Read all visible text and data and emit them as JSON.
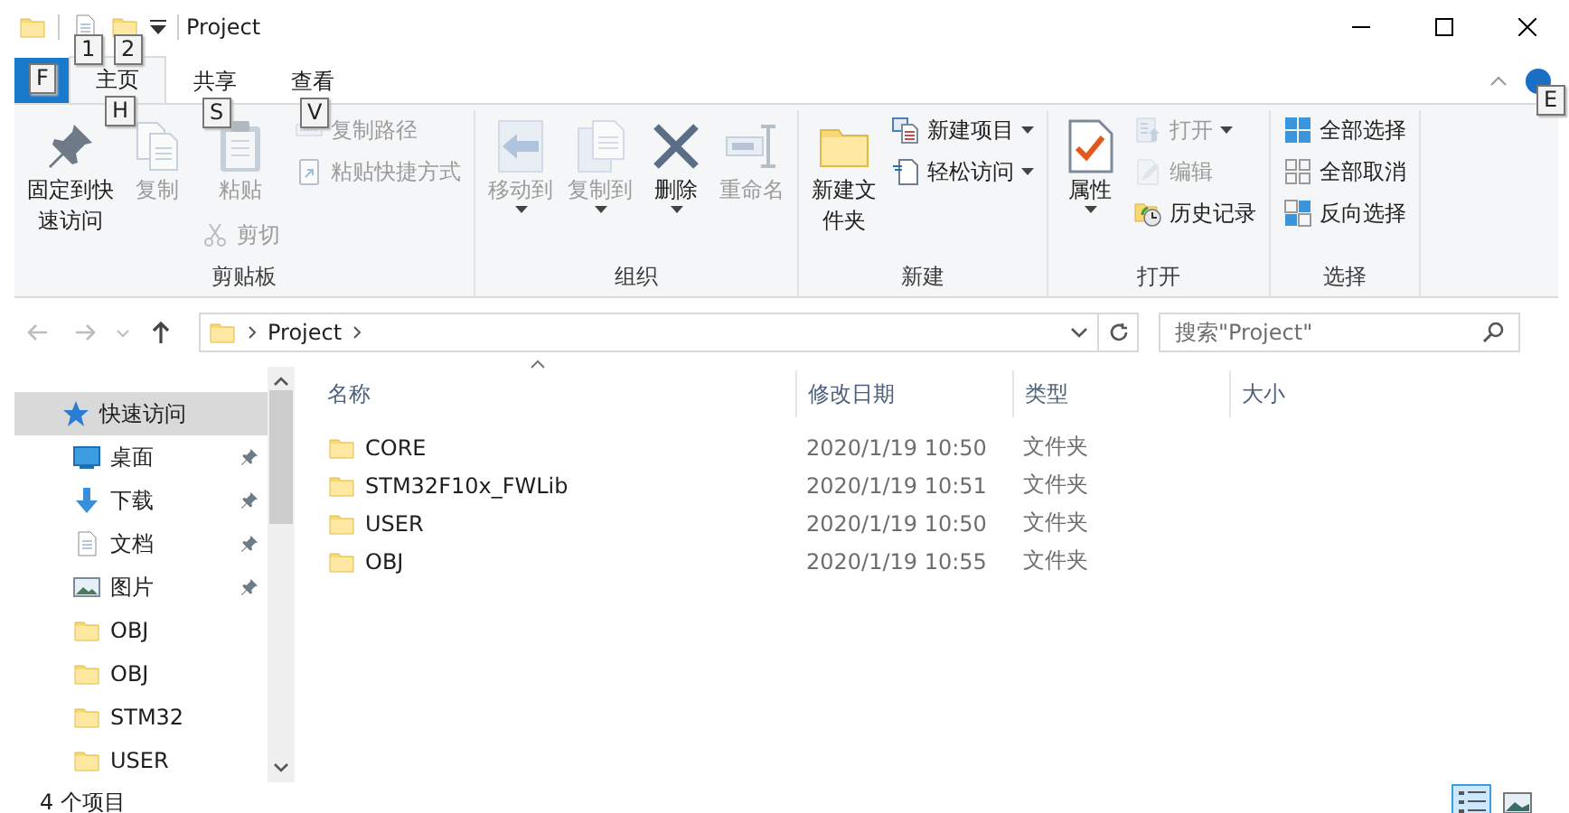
{
  "window": {
    "title": "Project"
  },
  "quick_access_toolbar": [
    {
      "keytip": "1"
    },
    {
      "keytip": "2"
    }
  ],
  "ribbon_tabs": [
    {
      "kind": "file",
      "keytip": "F",
      "selected": false
    },
    {
      "kind": "tab",
      "label": "主页",
      "keytip": "H",
      "selected": true
    },
    {
      "kind": "tab",
      "label": "共享",
      "keytip": "S",
      "selected": false
    },
    {
      "kind": "tab",
      "label": "查看",
      "keytip": "V",
      "selected": false
    }
  ],
  "help": {
    "keytip": "E"
  },
  "ribbon_groups": [
    {
      "label": "剪贴板",
      "columns": [
        [
          {
            "kind": "large",
            "label": "固定到快速访问",
            "disabled": false
          }
        ],
        [
          {
            "kind": "large",
            "label": "复制",
            "disabled": true
          }
        ],
        [
          {
            "kind": "large",
            "label": "粘贴",
            "disabled": true
          },
          {
            "kind": "small",
            "label": "剪切",
            "disabled": true
          }
        ],
        [
          {
            "kind": "small",
            "label": "复制路径",
            "disabled": true
          },
          {
            "kind": "small",
            "label": "粘贴快捷方式",
            "disabled": true
          }
        ]
      ]
    },
    {
      "label": "组织",
      "columns": [
        [
          {
            "kind": "large",
            "label": "移动到",
            "dropdown": true,
            "disabled": true
          }
        ],
        [
          {
            "kind": "large",
            "label": "复制到",
            "dropdown": true,
            "disabled": true
          }
        ],
        [
          {
            "kind": "large",
            "label": "删除",
            "dropdown": true,
            "disabled": false
          }
        ],
        [
          {
            "kind": "large",
            "label": "重命名",
            "disabled": true
          }
        ]
      ]
    },
    {
      "label": "新建",
      "columns": [
        [
          {
            "kind": "large",
            "label": "新建文件夹",
            "disabled": false
          }
        ],
        [
          {
            "kind": "small",
            "label": "新建项目",
            "dropdown": true,
            "disabled": false
          },
          {
            "kind": "small",
            "label": "轻松访问",
            "dropdown": true,
            "disabled": false
          }
        ]
      ]
    },
    {
      "label": "打开",
      "columns": [
        [
          {
            "kind": "large",
            "label": "属性",
            "dropdown": true,
            "disabled": false
          }
        ],
        [
          {
            "kind": "small",
            "label": "打开",
            "dropdown": true,
            "disabled": true
          },
          {
            "kind": "small",
            "label": "编辑",
            "disabled": true
          },
          {
            "kind": "small",
            "label": "历史记录",
            "disabled": false
          }
        ]
      ]
    },
    {
      "label": "选择",
      "columns": [
        [
          {
            "kind": "small",
            "label": "全部选择",
            "disabled": false
          },
          {
            "kind": "small",
            "label": "全部取消",
            "disabled": false
          },
          {
            "kind": "small",
            "label": "反向选择",
            "disabled": false
          }
        ]
      ]
    }
  ],
  "nav_buttons": [
    {
      "kind": "back",
      "disabled": true
    },
    {
      "kind": "forward",
      "disabled": true
    },
    {
      "kind": "recent",
      "disabled": true
    },
    {
      "kind": "up",
      "disabled": false
    }
  ],
  "address": {
    "path": [
      "Project"
    ]
  },
  "search": {
    "placeholder": "搜索\"Project\""
  },
  "navigation": [
    {
      "label": "快速访问",
      "selected": true,
      "children": [
        {
          "label": "桌面",
          "pinned": true,
          "selected": false
        },
        {
          "label": "下载",
          "pinned": true,
          "selected": false
        },
        {
          "label": "文档",
          "pinned": true,
          "selected": false
        },
        {
          "label": "图片",
          "pinned": true,
          "selected": false
        },
        {
          "label": "OBJ",
          "pinned": false,
          "selected": false
        },
        {
          "label": "OBJ",
          "pinned": false,
          "selected": false
        },
        {
          "label": "STM32",
          "pinned": false,
          "selected": false
        },
        {
          "label": "USER",
          "pinned": false,
          "selected": false
        }
      ]
    }
  ],
  "columns": [
    {
      "label": "名称",
      "sorted": true
    },
    {
      "label": "修改日期",
      "sorted": false
    },
    {
      "label": "类型",
      "sorted": false
    },
    {
      "label": "大小",
      "sorted": false
    }
  ],
  "rows": [
    {
      "name": "CORE",
      "modified": "2020/1/19 10:50",
      "type": "文件夹"
    },
    {
      "name": "STM32F10x_FWLib",
      "modified": "2020/1/19 10:51",
      "type": "文件夹"
    },
    {
      "name": "USER",
      "modified": "2020/1/19 10:50",
      "type": "文件夹"
    },
    {
      "name": "OBJ",
      "modified": "2020/1/19 10:55",
      "type": "文件夹"
    }
  ],
  "status_bar": {
    "item_count": "4 个项目"
  },
  "view_buttons": [
    {
      "kind": "details",
      "selected": true
    },
    {
      "kind": "thumbnails",
      "selected": false
    }
  ]
}
